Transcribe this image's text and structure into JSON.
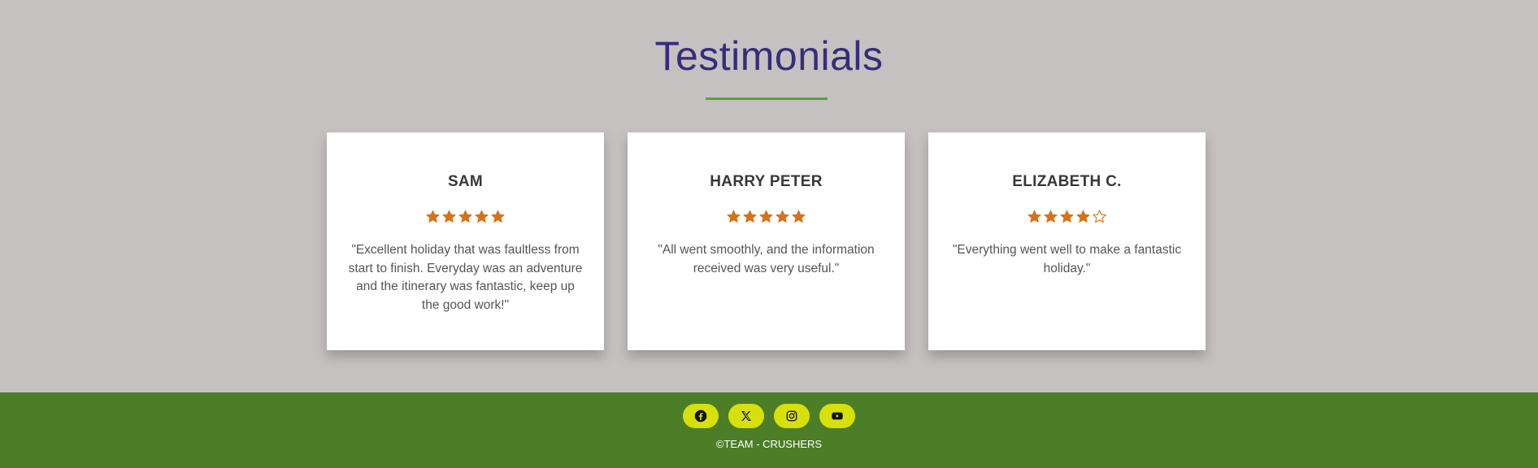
{
  "section": {
    "title": "Testimonials",
    "accent_color": "#57a53b",
    "title_color": "#352d7b",
    "star_color": "#d4731a"
  },
  "testimonials": [
    {
      "name": "SAM",
      "rating": 5,
      "max_rating": 5,
      "quote": "\"Excellent holiday that was faultless from start to finish. Everyday was an adventure and the itinerary was fantastic, keep up the good work!\""
    },
    {
      "name": "HARRY PETER",
      "rating": 5,
      "max_rating": 5,
      "quote": "\"All went smoothly, and the information received was very useful.\""
    },
    {
      "name": "ELIZABETH C.",
      "rating": 4,
      "max_rating": 5,
      "quote": "\"Everything went well to make a fantastic holiday.\""
    }
  ],
  "footer": {
    "background": "#4c7d27",
    "social_button_color": "#d7e00b",
    "socials": [
      {
        "icon": "facebook-icon"
      },
      {
        "icon": "x-twitter-icon"
      },
      {
        "icon": "instagram-icon"
      },
      {
        "icon": "youtube-icon"
      }
    ],
    "copyright": "©TEAM - CRUSHERS"
  }
}
